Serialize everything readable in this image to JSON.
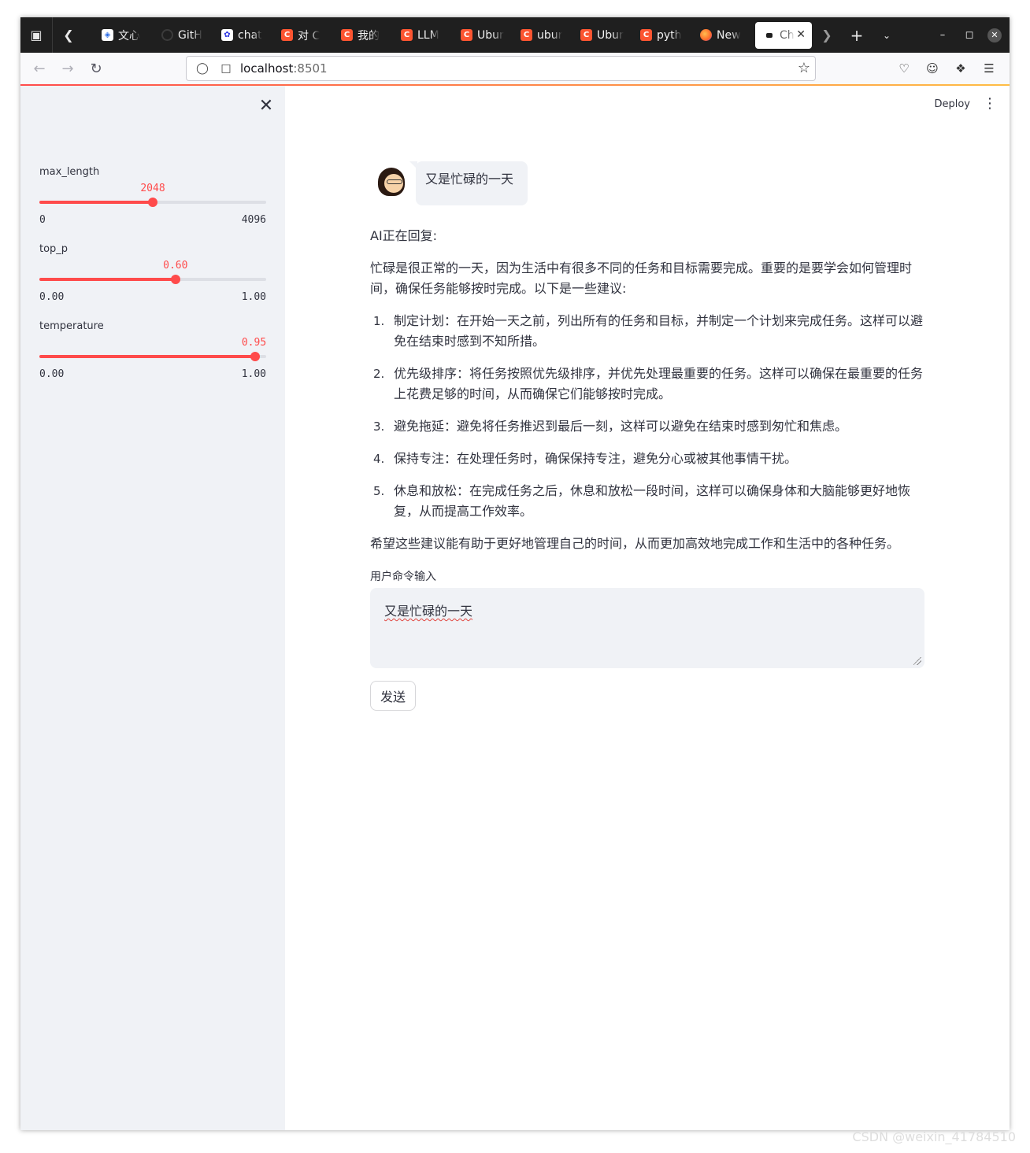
{
  "browser": {
    "tabs": [
      {
        "label": "文心",
        "icon": "wenxin-icon",
        "fav": "wx",
        "glyph": "◈"
      },
      {
        "label": "GitH",
        "icon": "github-icon",
        "fav": "gh",
        "glyph": ""
      },
      {
        "label": "chat",
        "icon": "baidu-icon",
        "fav": "bd",
        "glyph": "✿"
      },
      {
        "label": "对 C",
        "icon": "csdn-icon",
        "fav": "c",
        "glyph": "C"
      },
      {
        "label": "我的",
        "icon": "csdn-icon",
        "fav": "c",
        "glyph": "C"
      },
      {
        "label": "LLM",
        "icon": "csdn-icon",
        "fav": "c",
        "glyph": "C"
      },
      {
        "label": "Ubur",
        "icon": "csdn-icon",
        "fav": "c",
        "glyph": "C"
      },
      {
        "label": "ubur",
        "icon": "csdn-icon",
        "fav": "c",
        "glyph": "C"
      },
      {
        "label": "Ubur",
        "icon": "csdn-icon",
        "fav": "c",
        "glyph": "C"
      },
      {
        "label": "pyth",
        "icon": "csdn-icon",
        "fav": "c",
        "glyph": "C"
      },
      {
        "label": "New",
        "icon": "firefox-icon",
        "fav": "ff",
        "glyph": ""
      }
    ],
    "active_tab": {
      "label": "Ch",
      "icon": "streamlit-icon"
    },
    "url_host": "localhost",
    "url_port": ":8501"
  },
  "sidebar": {
    "sliders": [
      {
        "label": "max_length",
        "value_text": "2048",
        "min_text": "0",
        "max_text": "4096",
        "fraction": 0.5
      },
      {
        "label": "top_p",
        "value_text": "0.60",
        "min_text": "0.00",
        "max_text": "1.00",
        "fraction": 0.6
      },
      {
        "label": "temperature",
        "value_text": "0.95",
        "min_text": "0.00",
        "max_text": "1.00",
        "fraction": 0.95
      }
    ]
  },
  "header": {
    "deploy_label": "Deploy"
  },
  "chat": {
    "user_message": "又是忙碌的一天",
    "ai_status": "AI正在回复:",
    "intro": "忙碌是很正常的一天，因为生活中有很多不同的任务和目标需要完成。重要的是要学会如何管理时间，确保任务能够按时完成。以下是一些建议:",
    "items": [
      {
        "num": "1.",
        "text": "制定计划：在开始一天之前，列出所有的任务和目标，并制定一个计划来完成任务。这样可以避免在结束时感到不知所措。"
      },
      {
        "num": "2.",
        "text": "优先级排序：将任务按照优先级排序，并优先处理最重要的任务。这样可以确保在最重要的任务上花费足够的时间，从而确保它们能够按时完成。"
      },
      {
        "num": "3.",
        "text": "避免拖延：避免将任务推迟到最后一刻，这样可以避免在结束时感到匆忙和焦虑。"
      },
      {
        "num": "4.",
        "text": "保持专注：在处理任务时，确保保持专注，避免分心或被其他事情干扰。"
      },
      {
        "num": "5.",
        "text": "休息和放松：在完成任务之后，休息和放松一段时间，这样可以确保身体和大脑能够更好地恢复，从而提高工作效率。"
      }
    ],
    "outro": "希望这些建议能有助于更好地管理自己的时间，从而更加高效地完成工作和生活中的各种任务。"
  },
  "input": {
    "label": "用户命令输入",
    "value": "又是忙碌的一天",
    "send_label": "发送"
  },
  "watermark": "CSDN @weixin_41784510",
  "colors": {
    "accent": "#ff4b4b",
    "sidebar_bg": "#f0f2f6",
    "text": "#31333f"
  }
}
